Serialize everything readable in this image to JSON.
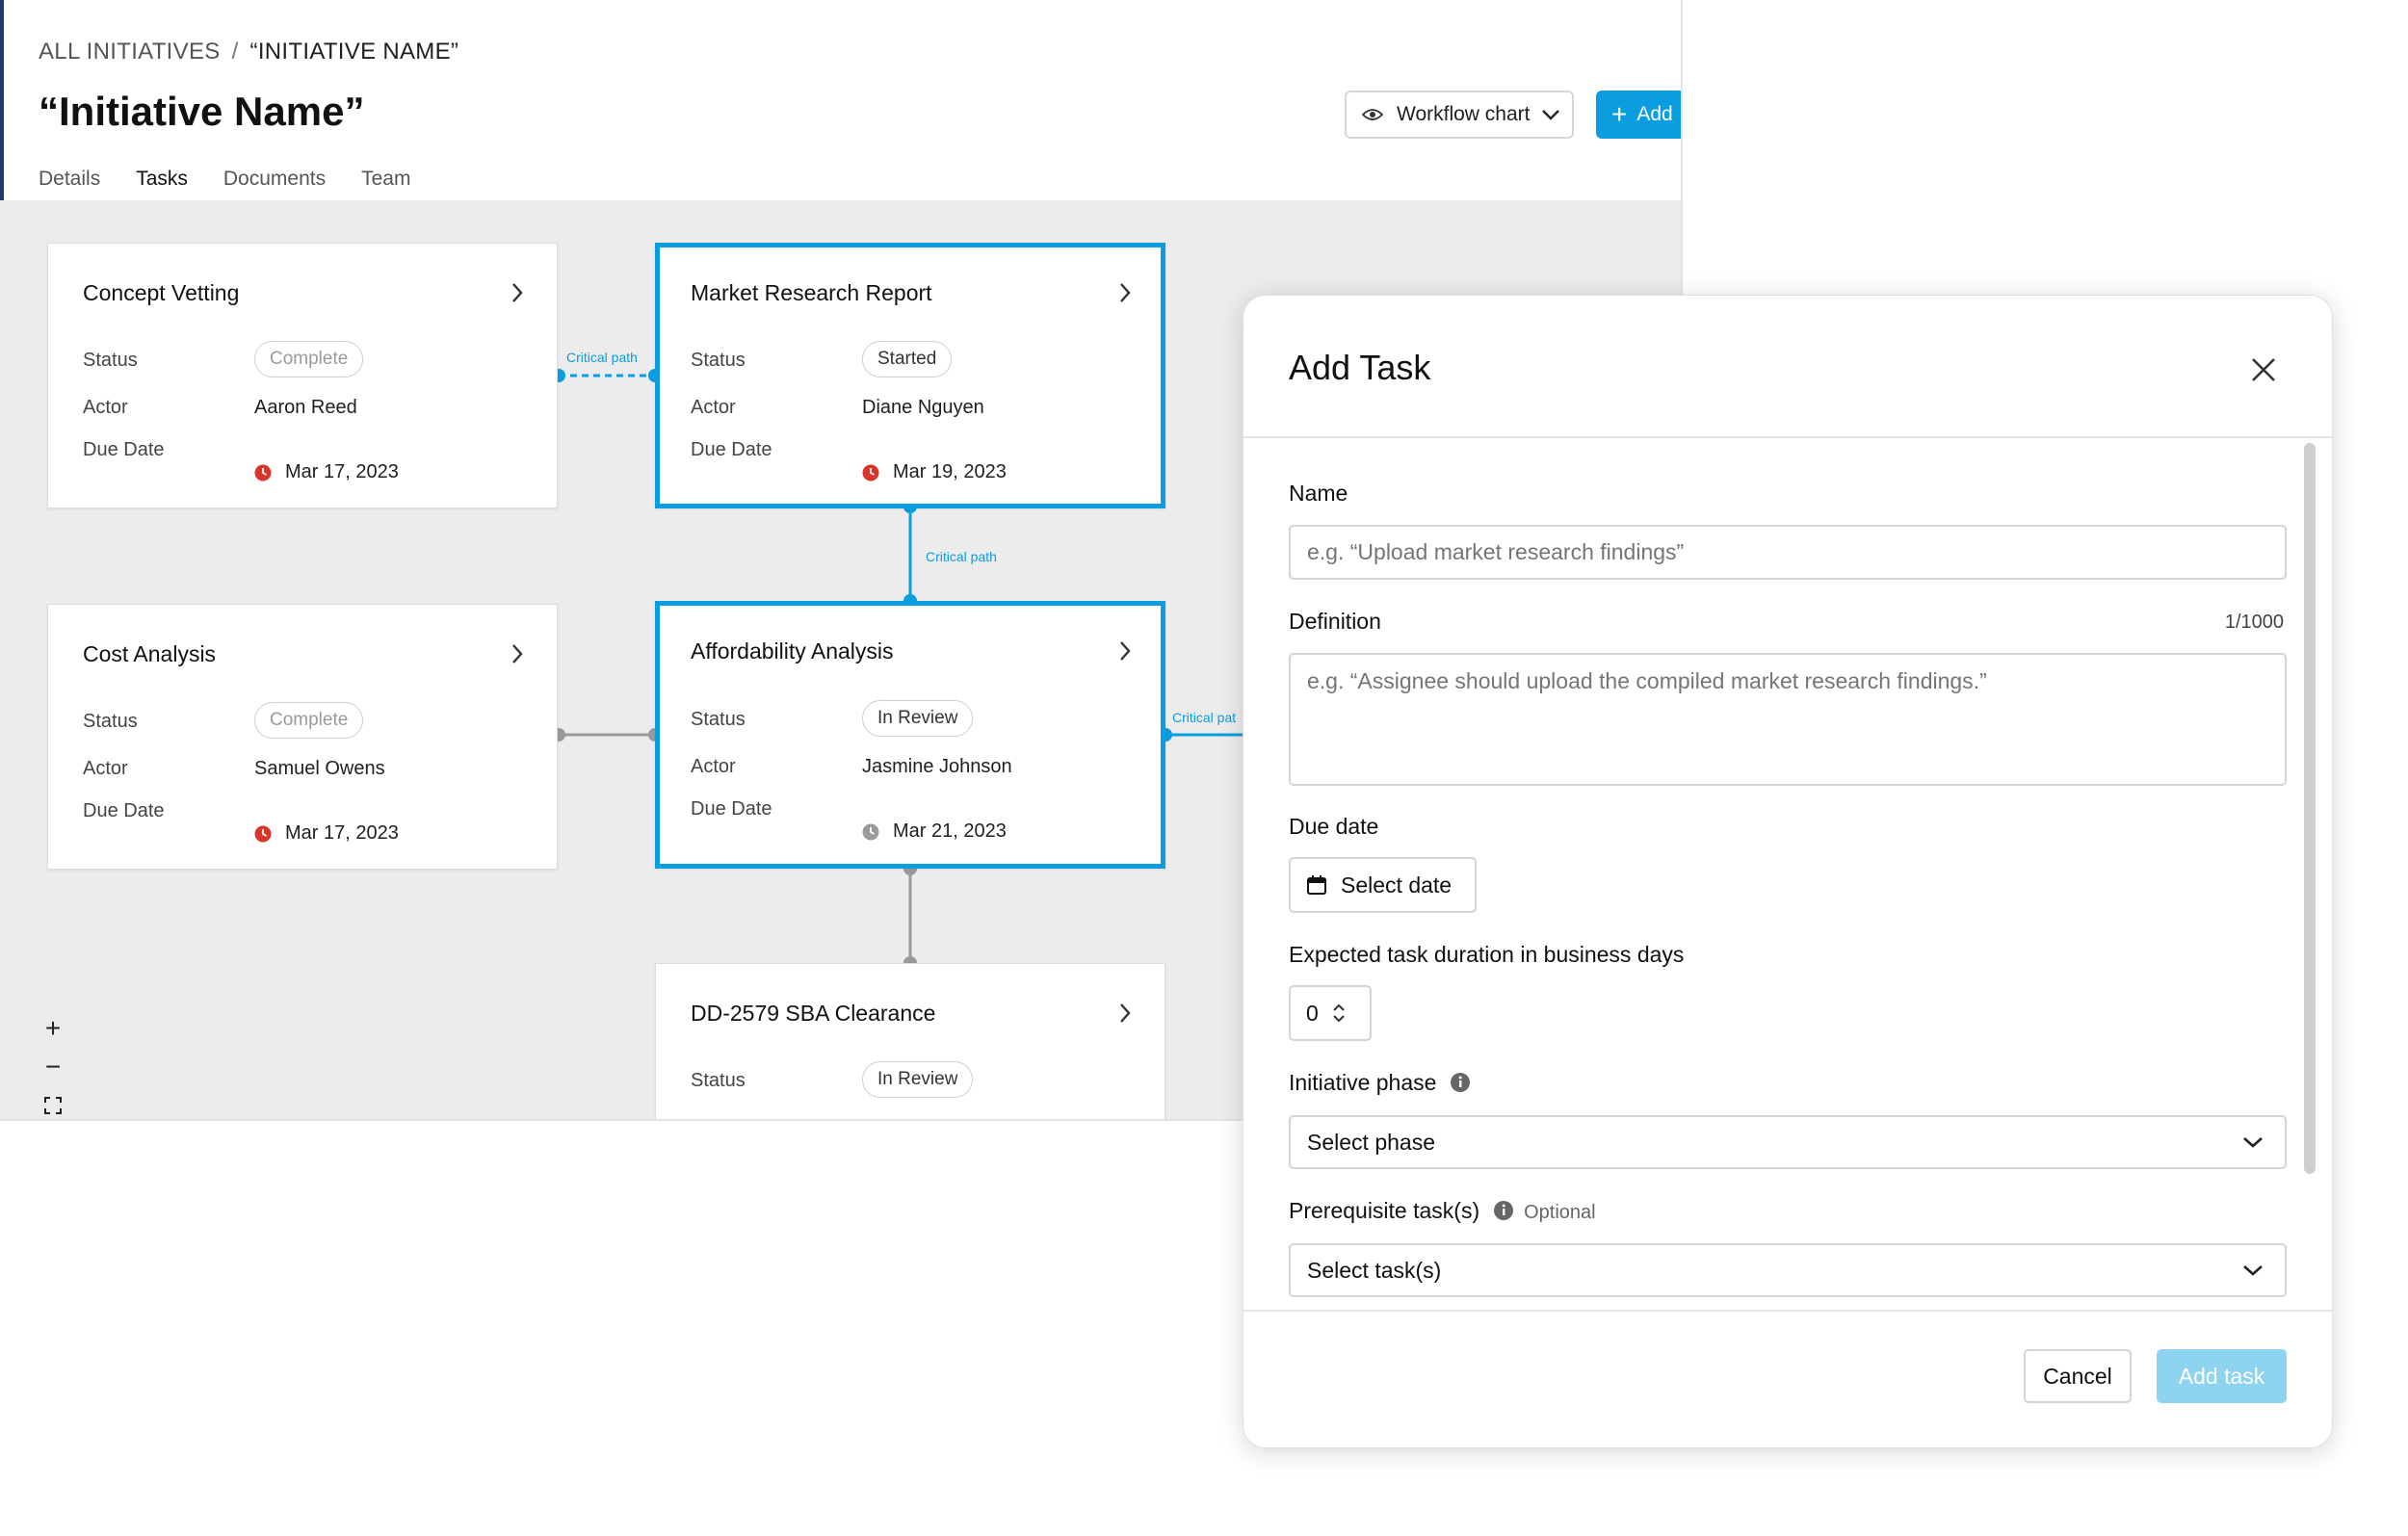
{
  "breadcrumb": {
    "root": "ALL INITIATIVES",
    "separator": "/",
    "current": "“INITIATIVE NAME”"
  },
  "page_title": "“Initiative Name”",
  "toolbar": {
    "workflow_label": "Workflow chart",
    "add_label": "Add"
  },
  "tabs": [
    {
      "label": "Details",
      "active": false
    },
    {
      "label": "Tasks",
      "active": true
    },
    {
      "label": "Documents",
      "active": false
    },
    {
      "label": "Team",
      "active": false
    }
  ],
  "field_labels": {
    "status": "Status",
    "actor": "Actor",
    "due": "Due Date"
  },
  "cards": [
    {
      "title": "Concept Vetting",
      "status": "Complete",
      "actor": "Aaron Reed",
      "due": "Mar 17, 2023",
      "due_state": "overdue"
    },
    {
      "title": "Market Research Report",
      "status": "Started",
      "actor": "Diane Nguyen",
      "due": "Mar 19, 2023",
      "due_state": "overdue"
    },
    {
      "title": "Cost Analysis",
      "status": "Complete",
      "actor": "Samuel Owens",
      "due": "Mar 17, 2023",
      "due_state": "overdue"
    },
    {
      "title": "Affordability Analysis",
      "status": "In Review",
      "actor": "Jasmine Johnson",
      "due": "Mar 21, 2023",
      "due_state": "pending"
    },
    {
      "title": "DD-2579 SBA Clearance",
      "status": "In Review"
    }
  ],
  "connectors": {
    "critical_path": "Critical path",
    "critical_path_clipped": "Critical pat"
  },
  "zoom": {
    "in": "+",
    "out": "−"
  },
  "colors": {
    "accent": "#0a9ee0",
    "overdue": "#d9352a",
    "pending": "#9a9a9a",
    "canvas": "#ececec"
  },
  "modal": {
    "title": "Add Task",
    "name_label": "Name",
    "name_placeholder": "e.g. “Upload market research findings”",
    "definition_label": "Definition",
    "definition_counter": "1/1000",
    "definition_placeholder": "e.g. “Assignee should upload the compiled market research findings.”",
    "due_label": "Due date",
    "select_date": "Select date",
    "duration_label": "Expected task duration in business days",
    "duration_value": "0",
    "phase_label": "Initiative phase",
    "phase_value": "Select phase",
    "prereq_label": "Prerequisite task(s)",
    "prereq_optional": "Optional",
    "prereq_value": "Select task(s)",
    "cancel": "Cancel",
    "add_task": "Add task"
  }
}
